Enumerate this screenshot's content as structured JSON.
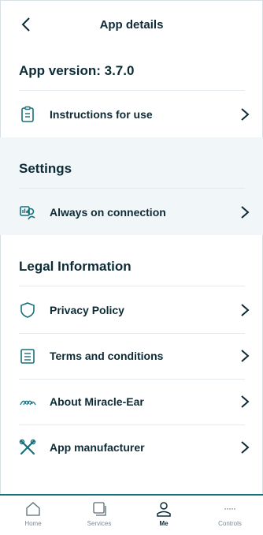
{
  "header": {
    "title": "App details"
  },
  "app_version": "App version: 3.7.0",
  "items": {
    "instructions": "Instructions for use",
    "always_on": "Always on connection",
    "privacy": "Privacy Policy",
    "terms": "Terms and conditions",
    "about": "About Miracle-Ear",
    "manufacturer": "App manufacturer"
  },
  "sections": {
    "settings": "Settings",
    "legal": "Legal Information"
  },
  "tabs": [
    {
      "label": "Home",
      "icon": "home-icon",
      "active": false
    },
    {
      "label": "Services",
      "icon": "services-icon",
      "active": false
    },
    {
      "label": "Me",
      "icon": "person-icon",
      "active": true
    },
    {
      "label": "Controls",
      "icon": "dots-icon",
      "active": false
    }
  ],
  "colors": {
    "accent": "#17707a",
    "text": "#0d2b36",
    "band": "#f1f6f8"
  }
}
